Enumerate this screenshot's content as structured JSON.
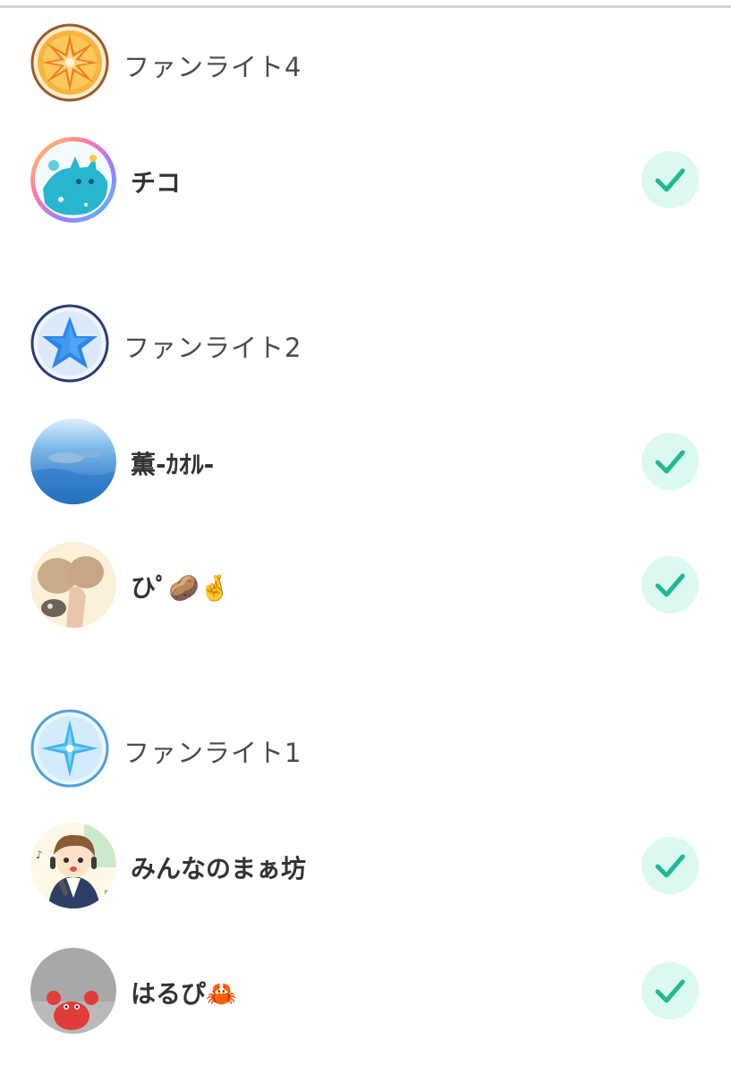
{
  "groups": [
    {
      "level_label": "ファンライト4",
      "badge_icon": "gold-compass-star-icon",
      "members": [
        {
          "name": "チコ",
          "selected": true,
          "avatar": "teal-cat-art-avatar"
        }
      ]
    },
    {
      "level_label": "ファンライト2",
      "badge_icon": "blue-star-icon",
      "members": [
        {
          "name": "薫-ｶｵﾙ-",
          "selected": true,
          "avatar": "underwater-whale-avatar"
        },
        {
          "name": "ひﾟ🥔🤞",
          "selected": true,
          "avatar": "potato-hand-photo-avatar"
        }
      ]
    },
    {
      "level_label": "ファンライト1",
      "badge_icon": "light-blue-sparkle-icon",
      "members": [
        {
          "name": "みんなのまぁ坊",
          "selected": true,
          "avatar": "singing-boy-illustration-avatar"
        },
        {
          "name": "はるぴ🦀",
          "selected": true,
          "avatar": "red-crab-avatar"
        }
      ]
    }
  ],
  "colors": {
    "check_background": "#dbf8f1",
    "check_mark": "#21b893",
    "level_text": "#4a4a4a",
    "name_text": "#333333",
    "divider": "#d4d4d4"
  }
}
